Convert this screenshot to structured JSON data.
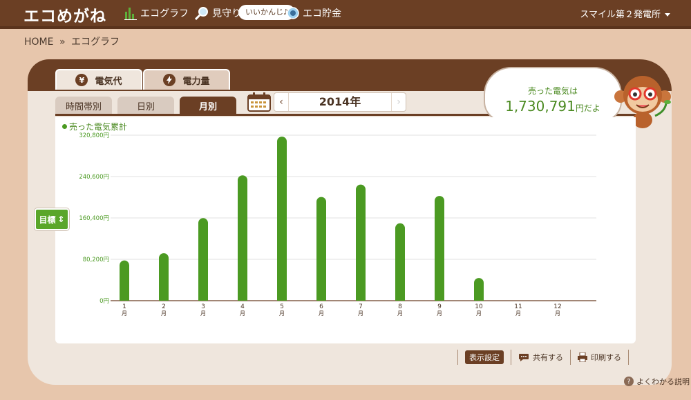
{
  "header": {
    "brand": "エコめがね",
    "nav": {
      "ecograph": "エコグラフ",
      "mimamori": "見守り",
      "bubble": "いいかんじ♪",
      "savings": "エコ貯金"
    },
    "plant_select": "スマイル第２発電所"
  },
  "breadcrumb": {
    "home": "HOME",
    "sep": "»",
    "current": "エコグラフ"
  },
  "tabs": {
    "cost": "電気代",
    "power": "電力量",
    "cost_icon": "¥"
  },
  "subtabs": {
    "hour": "時間帯別",
    "day": "日別",
    "month": "月別"
  },
  "year_nav": {
    "prev": "‹",
    "year": "2014年",
    "next": "›"
  },
  "bubble": {
    "line1": "売った電気は",
    "amount": "1,730,791",
    "suffix": "円だよ"
  },
  "target_button": {
    "label": "目標",
    "caret": "⇕"
  },
  "toolbar": {
    "display": "表示設定",
    "share": "共有する",
    "print": "印刷する"
  },
  "help": {
    "icon": "?",
    "label": "よくわかる説明"
  },
  "colors": {
    "brown": "#6b3f24",
    "green": "#4b9a22",
    "bg": "#e7c6ac"
  },
  "chart_data": {
    "type": "bar",
    "legend": "売った電気累計",
    "categories": [
      "1",
      "2",
      "3",
      "4",
      "5",
      "6",
      "7",
      "8",
      "9",
      "10",
      "11",
      "12"
    ],
    "category_unit": "月",
    "ytick_values": [
      0,
      80200,
      160400,
      240600,
      320800
    ],
    "yticks": [
      "0円",
      "80,200円",
      "160,400円",
      "240,600円",
      "320,800円"
    ],
    "ylim": [
      0,
      320800
    ],
    "values": [
      78000,
      92000,
      160000,
      243000,
      318000,
      201000,
      225000,
      150000,
      203000,
      44000,
      null,
      null
    ],
    "grid": true
  }
}
